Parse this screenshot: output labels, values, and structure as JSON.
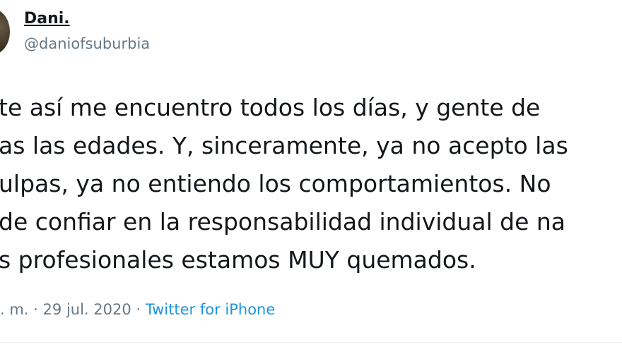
{
  "author": {
    "display_name": "Dani.",
    "handle": "@daniofsuburbia"
  },
  "tweet": {
    "lines": [
      "te así me encuentro todos los días, y gente de",
      "as las edades. Y, sinceramente, ya no acepto las",
      "ulpas, ya no entiendo los comportamientos. No",
      "de confiar en la responsabilidad individual de na",
      "s profesionales estamos MUY quemados."
    ]
  },
  "meta": {
    "time_fragment": ". m.",
    "separator_1": "·",
    "date": "29 jul. 2020",
    "separator_2": "·",
    "source": "Twitter for iPhone"
  },
  "colors": {
    "text": "#14171a",
    "secondary": "#657786",
    "link": "#1b95e0"
  }
}
